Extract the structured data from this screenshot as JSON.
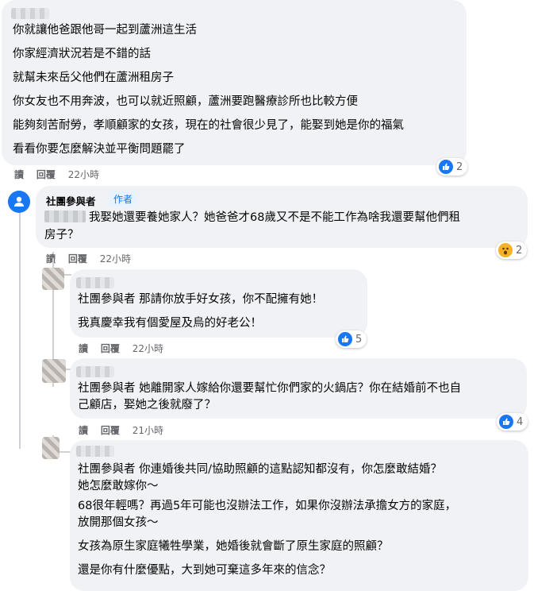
{
  "comment1": {
    "lines": [
      "你就讓他爸跟他哥一起到蘆洲這生活",
      "你家經濟狀況若是不錯的話",
      "就幫未來岳父他們在蘆洲租房子",
      "你女友也不用奔波，也可以就近照顧，蘆洲要跑醫療診所也比較方便",
      "能夠刻苦耐勞，孝順顧家的女孩，現在的社會很少見了，能娶到她是你的福氣",
      "看看你要怎麼解決並平衡問題罷了"
    ],
    "actions": {
      "read": "讀",
      "reply": "回覆",
      "time": "22小時"
    },
    "reaction_count": "2"
  },
  "reply1": {
    "author": "社團參與者",
    "badge": "作者",
    "lines": [
      "我娶她還要養她家人？她爸爸才68歲又不是不能工作為啥我還要幫他們租",
      "房子？"
    ],
    "actions": {
      "read": "讀",
      "reply": "回覆",
      "time": "22小時"
    },
    "reaction_count": "2"
  },
  "reply2": {
    "lines": [
      "社團參與者 那請你放手好女孩，你不配擁有她！",
      "我真慶幸我有個愛屋及烏的好老公！"
    ],
    "actions": {
      "read": "讀",
      "reply": "回覆",
      "time": "22小時"
    },
    "reaction_count": "5"
  },
  "reply3": {
    "lines": [
      "社團參與者 她離開家人嫁給你還要幫忙你們家的火鍋店？你在結婚前不也自",
      "己顧店，娶她之後就廢了？"
    ],
    "actions": {
      "read": "讀",
      "reply": "回覆",
      "time": "21小時"
    },
    "reaction_count": "4"
  },
  "reply4": {
    "lines": [
      "社團參與者 你連婚後共同/協助照顧的這點認知都沒有，你怎麼敢結婚？",
      "她怎麼敢嫁你～",
      "68很年輕嗎？再過5年可能也沒辦法工作，如果你沒辦法承擔女方的家庭，",
      "放開那個女孩～",
      "女孩為原生家庭犧牲學業，她婚後就會斷了原生家庭的照顧？",
      "還是你有什麼優點，大到她可棄這多年來的信念？"
    ]
  }
}
